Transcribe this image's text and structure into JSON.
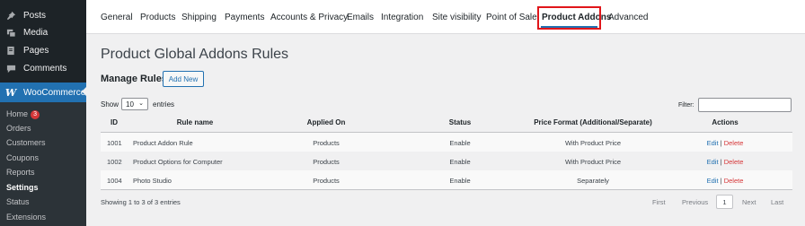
{
  "sidebar": {
    "items": [
      {
        "label": "Posts",
        "icon": "pin-icon"
      },
      {
        "label": "Media",
        "icon": "media-icon"
      },
      {
        "label": "Pages",
        "icon": "pages-icon"
      },
      {
        "label": "Comments",
        "icon": "comments-icon"
      }
    ],
    "woocommerce": {
      "label": "WooCommerce",
      "icon": "woo-icon"
    },
    "submenu": [
      {
        "label": "Home",
        "badge": "3"
      },
      {
        "label": "Orders"
      },
      {
        "label": "Customers"
      },
      {
        "label": "Coupons"
      },
      {
        "label": "Reports"
      },
      {
        "label": "Settings",
        "active": true
      },
      {
        "label": "Status"
      },
      {
        "label": "Extensions"
      }
    ]
  },
  "tabs": [
    {
      "label": "General"
    },
    {
      "label": "Products"
    },
    {
      "label": "Shipping"
    },
    {
      "label": "Payments"
    },
    {
      "label": "Accounts & Privacy"
    },
    {
      "label": "Emails"
    },
    {
      "label": "Integration"
    },
    {
      "label": "Site visibility"
    },
    {
      "label": "Point of Sale"
    },
    {
      "label": "Product Addons",
      "active": true
    },
    {
      "label": "Advanced"
    }
  ],
  "page": {
    "title": "Product Global Addons Rules",
    "manage_label": "Manage Rules",
    "add_new": "Add New"
  },
  "controls": {
    "show": "Show",
    "entries_value": "10",
    "entries": "entries",
    "filter": "Filter:"
  },
  "table": {
    "headers": [
      "ID",
      "Rule name",
      "Applied On",
      "Status",
      "Price Format (Additional/Separate)",
      "Actions"
    ],
    "rows": [
      {
        "id": "1001",
        "name": "Product Addon Rule",
        "applied": "Products",
        "status": "Enable",
        "format": "With Product Price",
        "edit": "Edit",
        "sep": " | ",
        "del": "Delete"
      },
      {
        "id": "1002",
        "name": "Product Options for Computer",
        "applied": "Products",
        "status": "Enable",
        "format": "With Product Price",
        "edit": "Edit",
        "sep": " | ",
        "del": "Delete"
      },
      {
        "id": "1004",
        "name": "Photo Studio",
        "applied": "Products",
        "status": "Enable",
        "format": "Separately",
        "edit": "Edit",
        "sep": " | ",
        "del": "Delete"
      }
    ]
  },
  "footer": {
    "info": "Showing 1 to 3 of 3 entries",
    "first": "First",
    "previous": "Previous",
    "current": "1",
    "next": "Next",
    "last": "Last"
  },
  "colors": {
    "sidebar": "#1d2327",
    "accent": "#2271b1",
    "highlight": "#e0151a",
    "delete": "#d63638"
  }
}
